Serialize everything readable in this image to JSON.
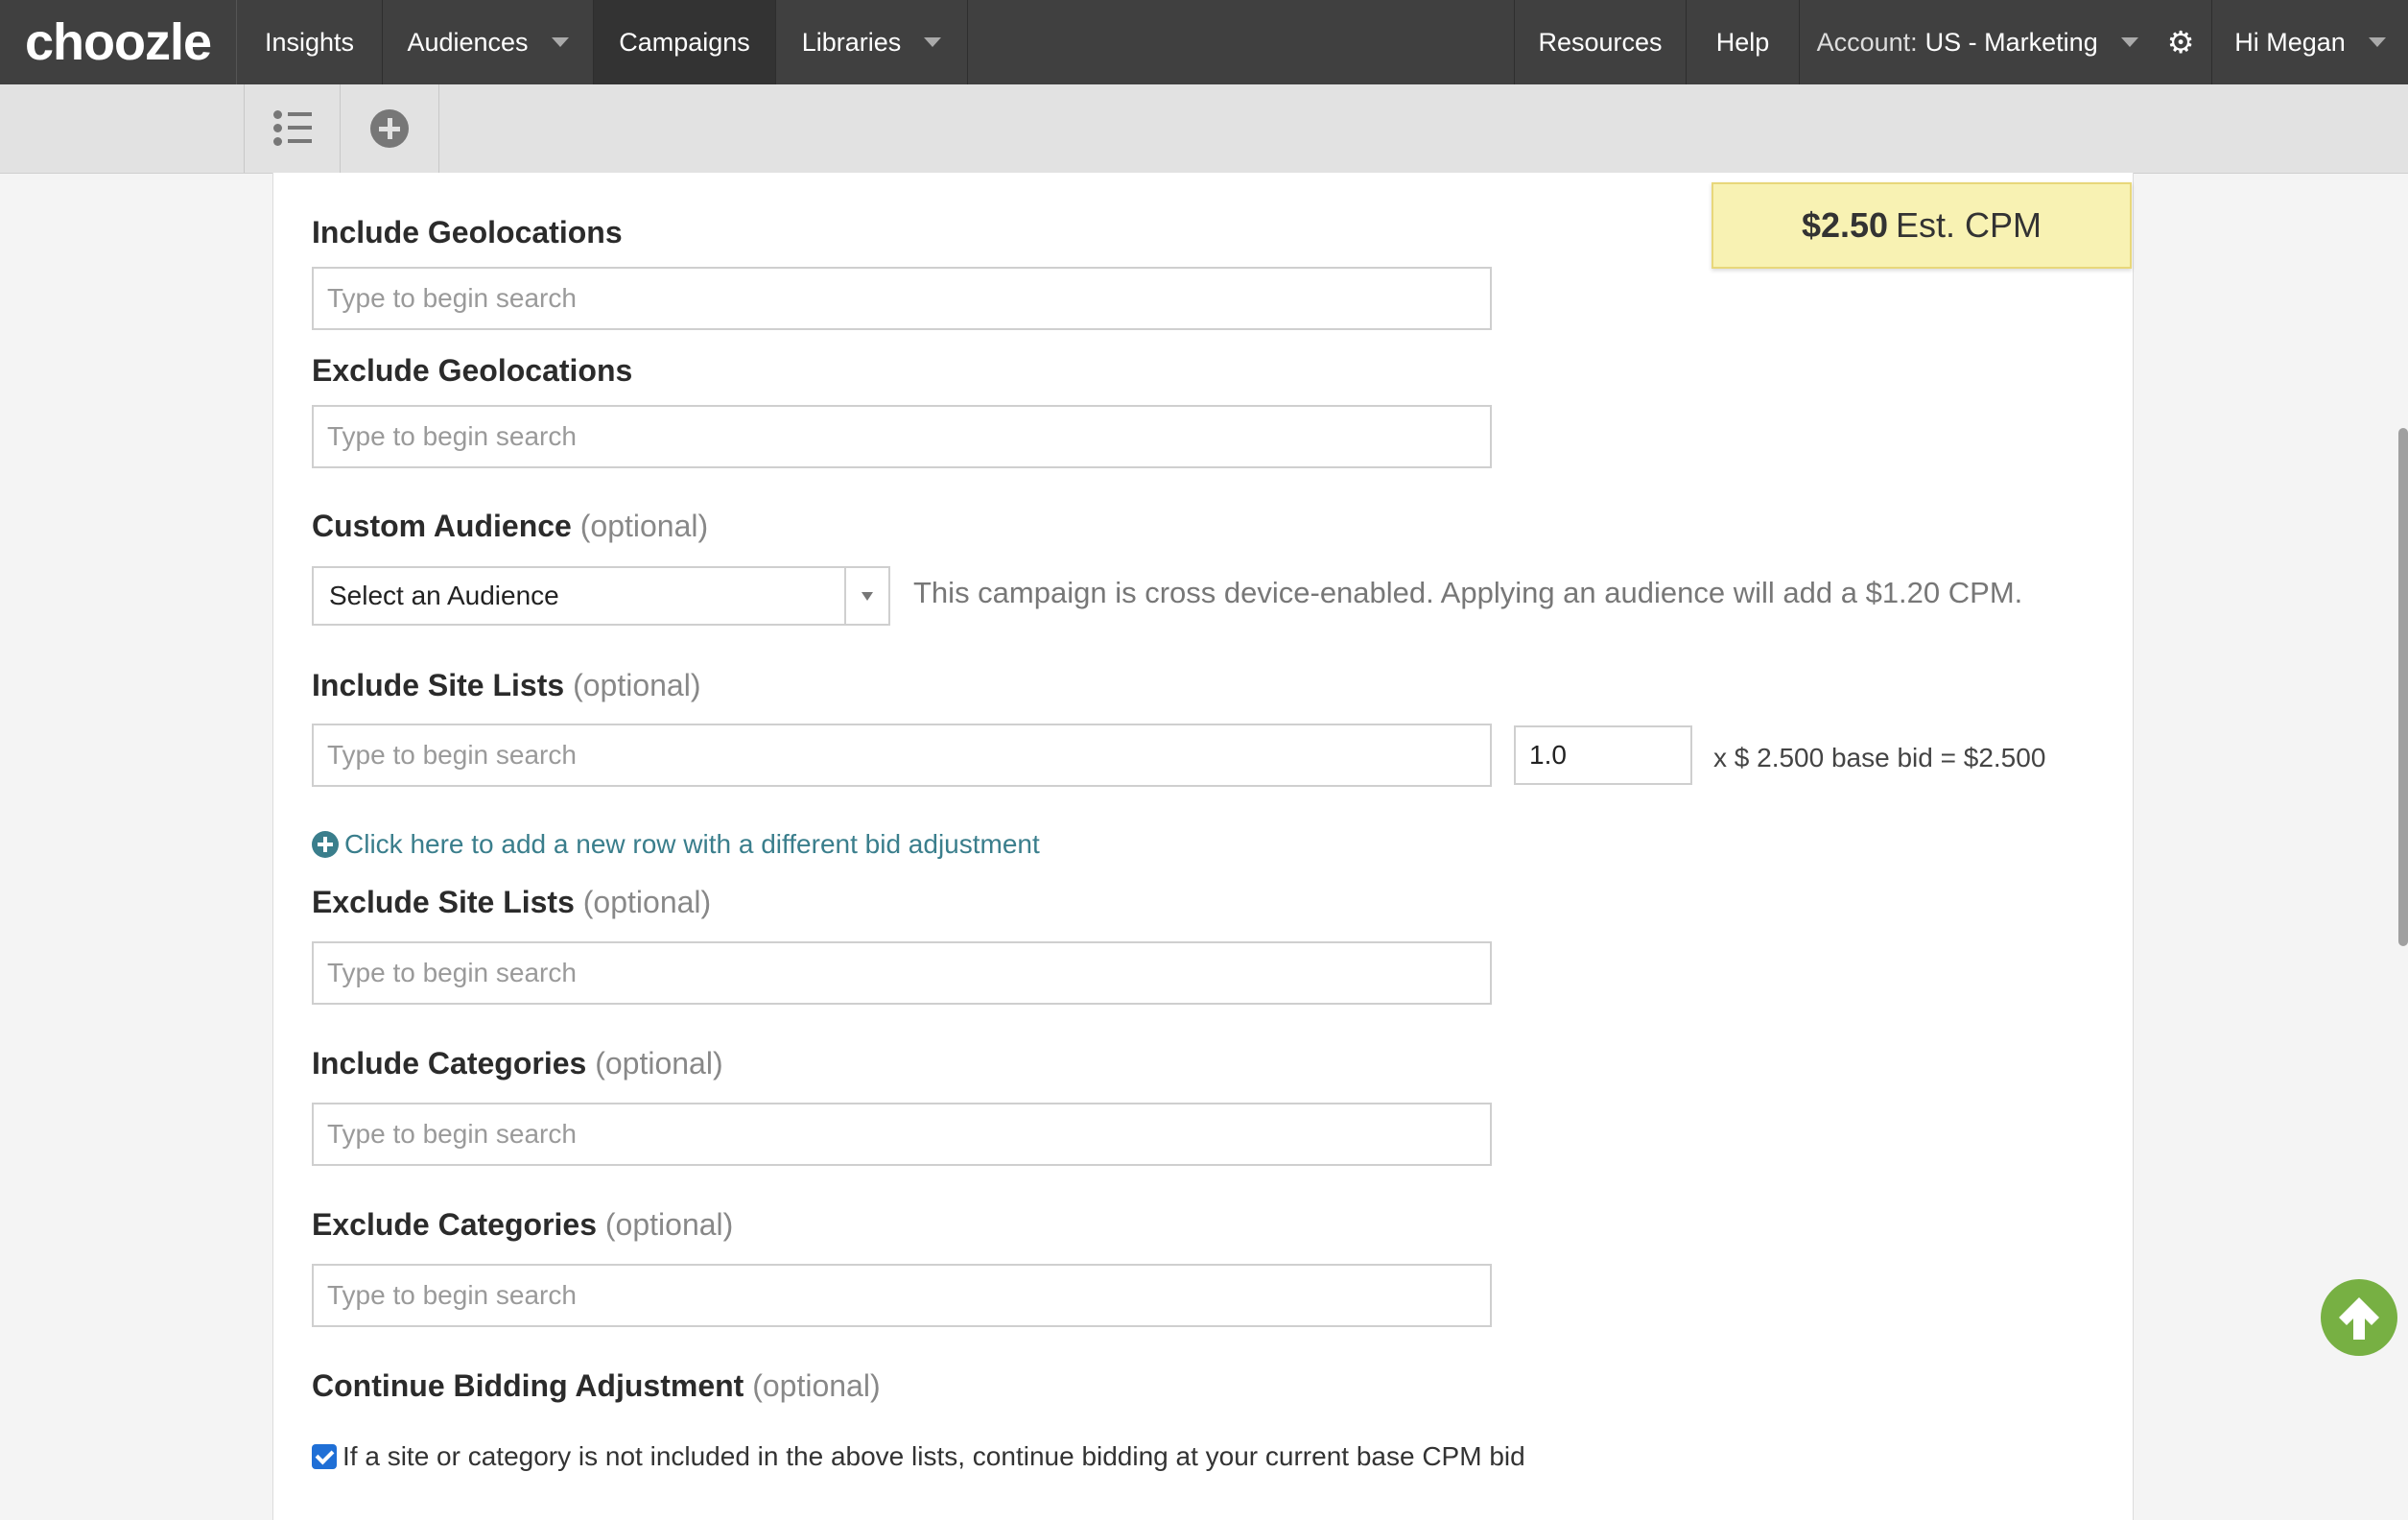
{
  "nav": {
    "logo": "choozle",
    "items": [
      {
        "label": "Insights"
      },
      {
        "label": "Audiences"
      },
      {
        "label": "Campaigns"
      },
      {
        "label": "Libraries"
      }
    ],
    "right_items": [
      {
        "label": "Resources"
      },
      {
        "label": "Help"
      }
    ],
    "account_prefix": "Account:",
    "account_name": "US - Marketing",
    "greeting": "Hi Megan"
  },
  "toolbar": {
    "list_icon": "list-icon",
    "add_icon": "plus-circle-icon"
  },
  "cpm": {
    "value": "$2.50",
    "label": "Est. CPM"
  },
  "form": {
    "include_geolocations": {
      "label": "Include Geolocations",
      "placeholder": "Type to begin search"
    },
    "exclude_geolocations": {
      "label": "Exclude Geolocations",
      "placeholder": "Type to begin search"
    },
    "custom_audience": {
      "label": "Custom Audience",
      "optional": "(optional)",
      "selected": "Select an Audience",
      "note": "This campaign is cross device-enabled. Applying an audience will add a $1.20 CPM."
    },
    "include_site_lists": {
      "label": "Include Site Lists",
      "optional": "(optional)",
      "placeholder": "Type to begin search",
      "bid_value": "1.0",
      "bid_text": "x $ 2.500 base bid = $2.500",
      "add_row_link": "Click here to add a new row with a different bid adjustment"
    },
    "exclude_site_lists": {
      "label": "Exclude Site Lists",
      "optional": "(optional)",
      "placeholder": "Type to begin search"
    },
    "include_categories": {
      "label": "Include Categories",
      "optional": "(optional)",
      "placeholder": "Type to begin search"
    },
    "exclude_categories": {
      "label": "Exclude Categories",
      "optional": "(optional)",
      "placeholder": "Type to begin search"
    },
    "continue_bidding": {
      "label": "Continue Bidding Adjustment",
      "optional": "(optional)",
      "checkbox_label": "If a site or category is not included in the above lists, continue bidding at your current base CPM bid",
      "checked": true
    }
  },
  "colors": {
    "nav_bg": "#404040",
    "link": "#3a7e8c",
    "cpm_bg": "#f8f2b3",
    "scroll_top_bg": "#77b043",
    "checkbox": "#1f6fd6"
  }
}
